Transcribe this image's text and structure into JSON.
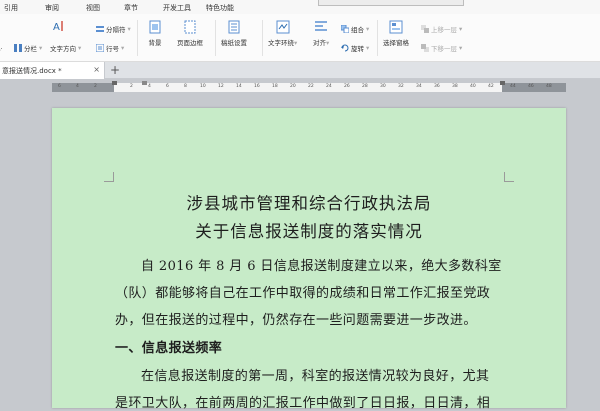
{
  "menu": [
    "引用",
    "审阅",
    "视图",
    "章节",
    "开发工具",
    "特色功能"
  ],
  "ribbon": {
    "text_direction": "文字方向",
    "columns": "分栏",
    "row_number": "行号",
    "separator": "分隔符",
    "background": "背景",
    "page_border": "页面边框",
    "draft_paper": "稿纸设置",
    "text_wrap": "文字环绕",
    "align": "对齐",
    "rotate": "旋转",
    "group": "组合",
    "selection_pane": "选择窗格",
    "bring_forward": "上移一层",
    "send_backward": "下移一层"
  },
  "tab": {
    "title": "意报送情况.docx *",
    "close": "×",
    "add": "+"
  },
  "ruler": [
    "6",
    "4",
    "2",
    "2",
    "4",
    "6",
    "8",
    "10",
    "12",
    "14",
    "16",
    "18",
    "20",
    "22",
    "24",
    "26",
    "28",
    "30",
    "32",
    "34",
    "36",
    "38",
    "40",
    "42",
    "44",
    "46",
    "48"
  ],
  "document": {
    "title_line1": "涉县城市管理和综合行政执法局",
    "title_line2": "关于信息报送制度的落实情况",
    "p1_line1": "自 2016 年 8 月 6 日信息报送制度建立以来，绝大多数科室",
    "p1_line2": "（队）都能够将自己在工作中取得的成绩和日常工作汇报至党政",
    "p1_line3": "办，但在报送的过程中，仍然存在一些问题需要进一步改进。",
    "heading1": "一、信息报送频率",
    "p2_line1": "在信息报送制度的第一周，科室的报送情况较为良好，尤其",
    "p2_line2": "是环卫大队，在前两周的汇报工作中做到了日日报，日日清，相"
  }
}
